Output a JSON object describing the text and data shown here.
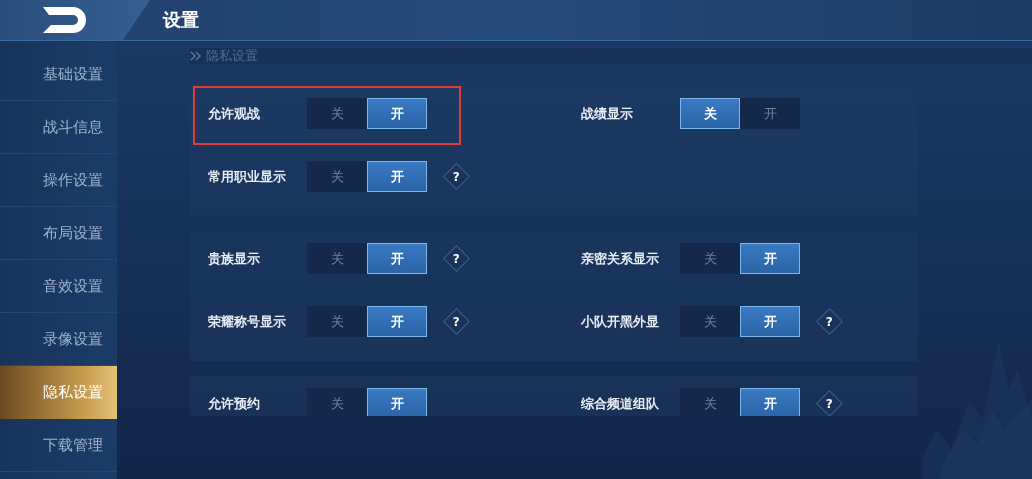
{
  "header": {
    "title": "设置"
  },
  "sidebar": {
    "items": [
      {
        "label": "基础设置",
        "selected": false
      },
      {
        "label": "战斗信息",
        "selected": false
      },
      {
        "label": "操作设置",
        "selected": false
      },
      {
        "label": "布局设置",
        "selected": false
      },
      {
        "label": "音效设置",
        "selected": false
      },
      {
        "label": "录像设置",
        "selected": false
      },
      {
        "label": "隐私设置",
        "selected": true
      },
      {
        "label": "下载管理",
        "selected": false
      }
    ]
  },
  "section": {
    "title": "隐私设置"
  },
  "groups": [
    {
      "rows": [
        [
          {
            "label": "允许观战",
            "highlighted": true,
            "options": [
              {
                "label": "关",
                "selected": false
              },
              {
                "label": "开",
                "selected": true
              }
            ]
          },
          {
            "label": "战绩显示",
            "highlighted": false,
            "options": [
              {
                "label": "关",
                "selected": true
              },
              {
                "label": "开",
                "selected": false
              }
            ]
          }
        ],
        [
          {
            "label": "常用职业显示",
            "highlighted": false,
            "help": "?",
            "options": [
              {
                "label": "关",
                "selected": false
              },
              {
                "label": "开",
                "selected": true
              }
            ]
          }
        ]
      ]
    },
    {
      "rows": [
        [
          {
            "label": "贵族显示",
            "highlighted": false,
            "help": "?",
            "options": [
              {
                "label": "关",
                "selected": false
              },
              {
                "label": "开",
                "selected": true
              }
            ]
          },
          {
            "label": "亲密关系显示",
            "highlighted": false,
            "options": [
              {
                "label": "关",
                "selected": false
              },
              {
                "label": "开",
                "selected": true
              }
            ]
          }
        ],
        [
          {
            "label": "荣耀称号显示",
            "highlighted": false,
            "help": "?",
            "options": [
              {
                "label": "关",
                "selected": false
              },
              {
                "label": "开",
                "selected": true
              }
            ]
          },
          {
            "label": "小队开黑外显",
            "highlighted": false,
            "help": "?",
            "options": [
              {
                "label": "关",
                "selected": false
              },
              {
                "label": "开",
                "selected": true
              }
            ]
          }
        ]
      ]
    },
    {
      "rows": [
        [
          {
            "label": "允许预约",
            "highlighted": false,
            "options": [
              {
                "label": "关",
                "selected": false
              },
              {
                "label": "开",
                "selected": true
              }
            ]
          },
          {
            "label": "综合频道组队",
            "highlighted": false,
            "help": "?",
            "options": [
              {
                "label": "关",
                "selected": false
              },
              {
                "label": "开",
                "selected": true
              }
            ]
          }
        ]
      ]
    }
  ]
}
